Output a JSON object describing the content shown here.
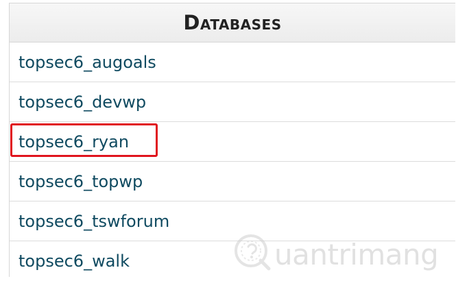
{
  "databases": {
    "header": "Databases",
    "items": [
      {
        "label": "topsec6_augoals"
      },
      {
        "label": "topsec6_devwp"
      },
      {
        "label": "topsec6_ryan"
      },
      {
        "label": "topsec6_topwp"
      },
      {
        "label": "topsec6_tswforum"
      },
      {
        "label": "topsec6_walk"
      }
    ],
    "highlighted_item": "topsec6_ryan"
  },
  "watermark": {
    "text": "uantrimang",
    "icon": "quantrimang-q-logo-icon"
  },
  "colors": {
    "link": "#0f4a60",
    "highlight": "#e0141e",
    "header_bg": "#f0f0f0"
  }
}
